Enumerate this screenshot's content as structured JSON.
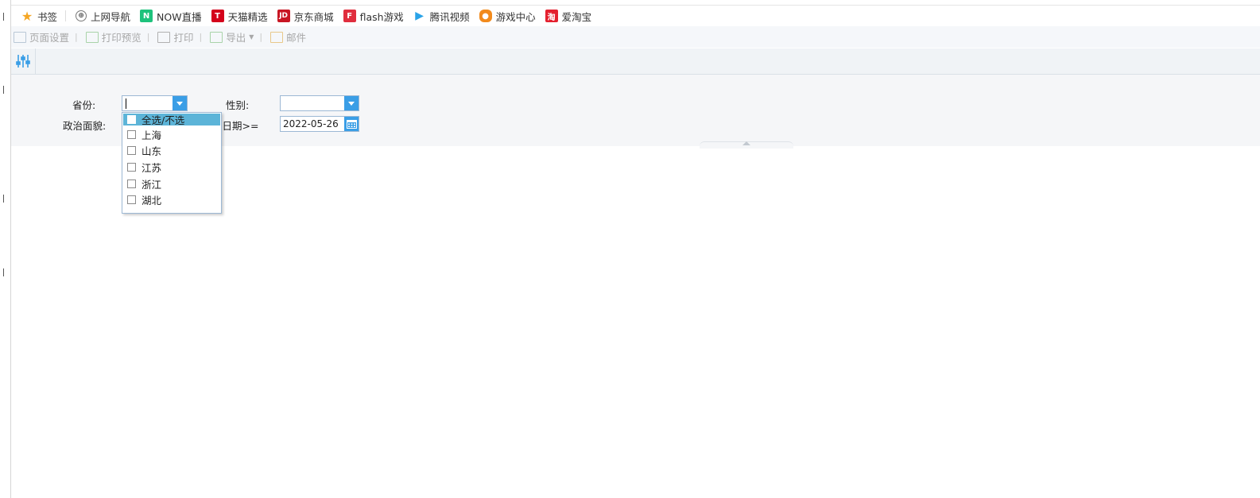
{
  "bookmarks": [
    {
      "label": "书签",
      "icon": "star-icon",
      "color": "#f5a623"
    },
    {
      "label": "上网导航",
      "icon": "globe-icon",
      "color": "#555555"
    },
    {
      "label": "NOW直播",
      "icon": "now-live-icon",
      "color": "#1ec27c"
    },
    {
      "label": "天猫精选",
      "icon": "tmall-icon",
      "color": "#d4021b"
    },
    {
      "label": "京东商城",
      "icon": "jd-icon",
      "color": "#c81623"
    },
    {
      "label": "flash游戏",
      "icon": "flash-game-icon",
      "color": "#e02e3e"
    },
    {
      "label": "腾讯视频",
      "icon": "tencent-video-icon",
      "color": "#2aa3e8"
    },
    {
      "label": "游戏中心",
      "icon": "gamepad-icon",
      "color": "#f28a1c"
    },
    {
      "label": "爱淘宝",
      "icon": "taobao-icon",
      "color": "#e4202f"
    }
  ],
  "toolbar": {
    "page_setup": "页面设置",
    "print_preview": "打印预览",
    "print": "打印",
    "export": "导出",
    "mail": "邮件"
  },
  "params": {
    "province_label": "省份:",
    "province_value": "",
    "gender_label": "性别:",
    "gender_value": "",
    "political_label": "政治面貌:",
    "birthdate_label": "生日期>=",
    "birthdate_value": "2022-05-26"
  },
  "province_options": [
    {
      "label": "全选/不选",
      "active": true
    },
    {
      "label": "上海",
      "active": false
    },
    {
      "label": "山东",
      "active": false
    },
    {
      "label": "江苏",
      "active": false
    },
    {
      "label": "浙江",
      "active": false
    },
    {
      "label": "湖北",
      "active": false
    }
  ],
  "colors": {
    "accent": "#3a9ee6",
    "highlight": "#5cb4d8"
  }
}
